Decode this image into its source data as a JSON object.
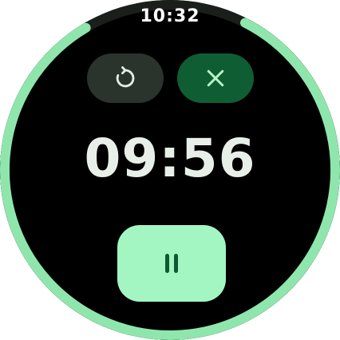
{
  "status_bar": {
    "time": "10:32"
  },
  "timer": {
    "remaining": "09:56",
    "progress_fraction": 0.84
  },
  "controls": {
    "reset_icon": "reset-icon",
    "cancel_icon": "close-icon",
    "pause_icon": "pause-icon"
  },
  "colors": {
    "progress_ring": "#8fe6ac",
    "reset_button_bg": "#2b332d",
    "cancel_button_bg": "#0f5e33",
    "pause_button_bg": "#a3f5c2",
    "timer_text": "#e8efe9"
  }
}
